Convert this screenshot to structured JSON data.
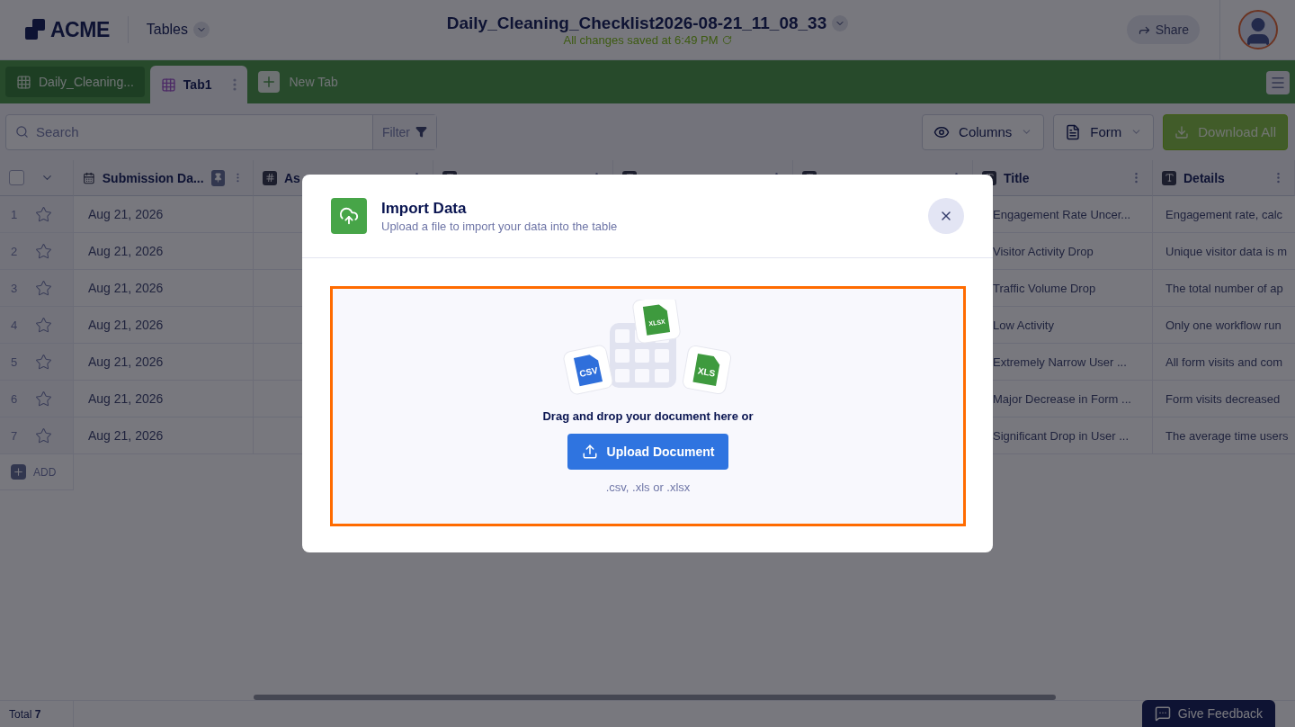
{
  "header": {
    "logo": "ACME",
    "section": "Tables",
    "title": "Daily_Cleaning_Checklist2026-08-21_11_08_33",
    "save_status": "All changes saved at 6:49 PM",
    "share": "Share"
  },
  "tabs": [
    {
      "label": "Daily_Cleaning...",
      "selected": false
    },
    {
      "label": "Tab1",
      "selected": true
    }
  ],
  "new_tab": "New Tab",
  "toolbar": {
    "search_placeholder": "Search",
    "filter": "Filter",
    "columns": "Columns",
    "form": "Form",
    "download": "Download All"
  },
  "table": {
    "select_all_checked": false,
    "columns": [
      {
        "label": "Submission Da...",
        "kind": "date",
        "pinned": true
      },
      {
        "label": "As",
        "kind": "number",
        "pinned": false
      },
      {
        "kind": "text",
        "pinned": false
      },
      {
        "kind": "text",
        "pinned": false
      },
      {
        "kind": "text",
        "pinned": false
      },
      {
        "label": "Title",
        "kind": "text",
        "pinned": false
      },
      {
        "label": "Details",
        "kind": "text",
        "pinned": false
      }
    ],
    "rows": [
      {
        "number": "1",
        "starred": false,
        "date": "Aug 21, 2026",
        "title": "Engagement Rate Uncer...",
        "details": "Engagement rate, calc"
      },
      {
        "number": "2",
        "starred": false,
        "date": "Aug 21, 2026",
        "title": "Visitor Activity Drop",
        "details": "Unique visitor data is m"
      },
      {
        "number": "3",
        "starred": false,
        "date": "Aug 21, 2026",
        "title": "Traffic Volume Drop",
        "details": "The total number of ap"
      },
      {
        "number": "4",
        "starred": false,
        "date": "Aug 21, 2026",
        "title": "Low Activity",
        "details": "Only one workflow run"
      },
      {
        "number": "5",
        "starred": false,
        "date": "Aug 21, 2026",
        "title": "Extremely Narrow User ...",
        "details": "All form visits and com"
      },
      {
        "number": "6",
        "starred": false,
        "date": "Aug 21, 2026",
        "title": "Major Decrease in Form ...",
        "details": "Form visits decreased"
      },
      {
        "number": "7",
        "starred": false,
        "date": "Aug 21, 2026",
        "title": "Significant Drop in User ...",
        "details": "The average time users"
      }
    ],
    "add": "ADD"
  },
  "footer": {
    "total": "Total **7**",
    "feedback": "Give Feedback"
  },
  "modal": {
    "title": "Import Data",
    "subtitle": "Upload a file to import your data into the table",
    "file_badges": [
      {
        "label": "CSV",
        "color": "#2f6fdb"
      },
      {
        "label": "XLSX",
        "color": "#3e9a3e"
      },
      {
        "label": "XLS",
        "color": "#3e9a3e"
      }
    ],
    "prompt": "Drag and drop your document here or",
    "button": "Upload Document",
    "formats": ".csv, .xls or .xlsx"
  }
}
